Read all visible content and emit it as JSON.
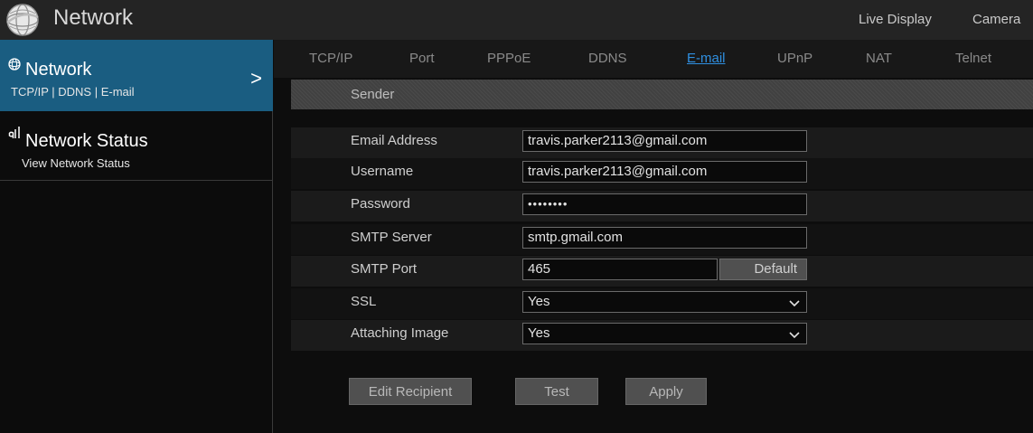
{
  "app": {
    "title": "Network"
  },
  "top_nav": {
    "live_display": "Live Display",
    "camera": "Camera"
  },
  "sidebar": {
    "items": [
      {
        "title": "Network",
        "subtitle": "TCP/IP | DDNS | E-mail",
        "icon": "globe-icon",
        "active": true
      },
      {
        "title": "Network Status",
        "subtitle": "View Network Status",
        "icon": "network-status-icon",
        "active": false
      }
    ]
  },
  "tabs": [
    {
      "label": "TCP/IP"
    },
    {
      "label": "Port"
    },
    {
      "label": "PPPoE"
    },
    {
      "label": "DDNS"
    },
    {
      "label": "E-mail",
      "active": true
    },
    {
      "label": "UPnP"
    },
    {
      "label": "NAT"
    },
    {
      "label": "Telnet"
    }
  ],
  "sender": {
    "header": "Sender",
    "email_label": "Email Address",
    "email_value": "travis.parker2113@gmail.com",
    "username_label": "Username",
    "username_value": "travis.parker2113@gmail.com",
    "password_label": "Password",
    "password_value": "••••••••",
    "smtp_server_label": "SMTP Server",
    "smtp_server_value": "smtp.gmail.com",
    "smtp_port_label": "SMTP Port",
    "smtp_port_value": "465",
    "default_label": "Default",
    "ssl_label": "SSL",
    "ssl_value": "Yes",
    "attaching_label": "Attaching Image",
    "attaching_value": "Yes"
  },
  "buttons": {
    "edit_recipient": "Edit Recipient",
    "test": "Test",
    "apply": "Apply"
  },
  "colors": {
    "active_blue": "#1a5d81",
    "tab_active": "#2f8fe0"
  }
}
